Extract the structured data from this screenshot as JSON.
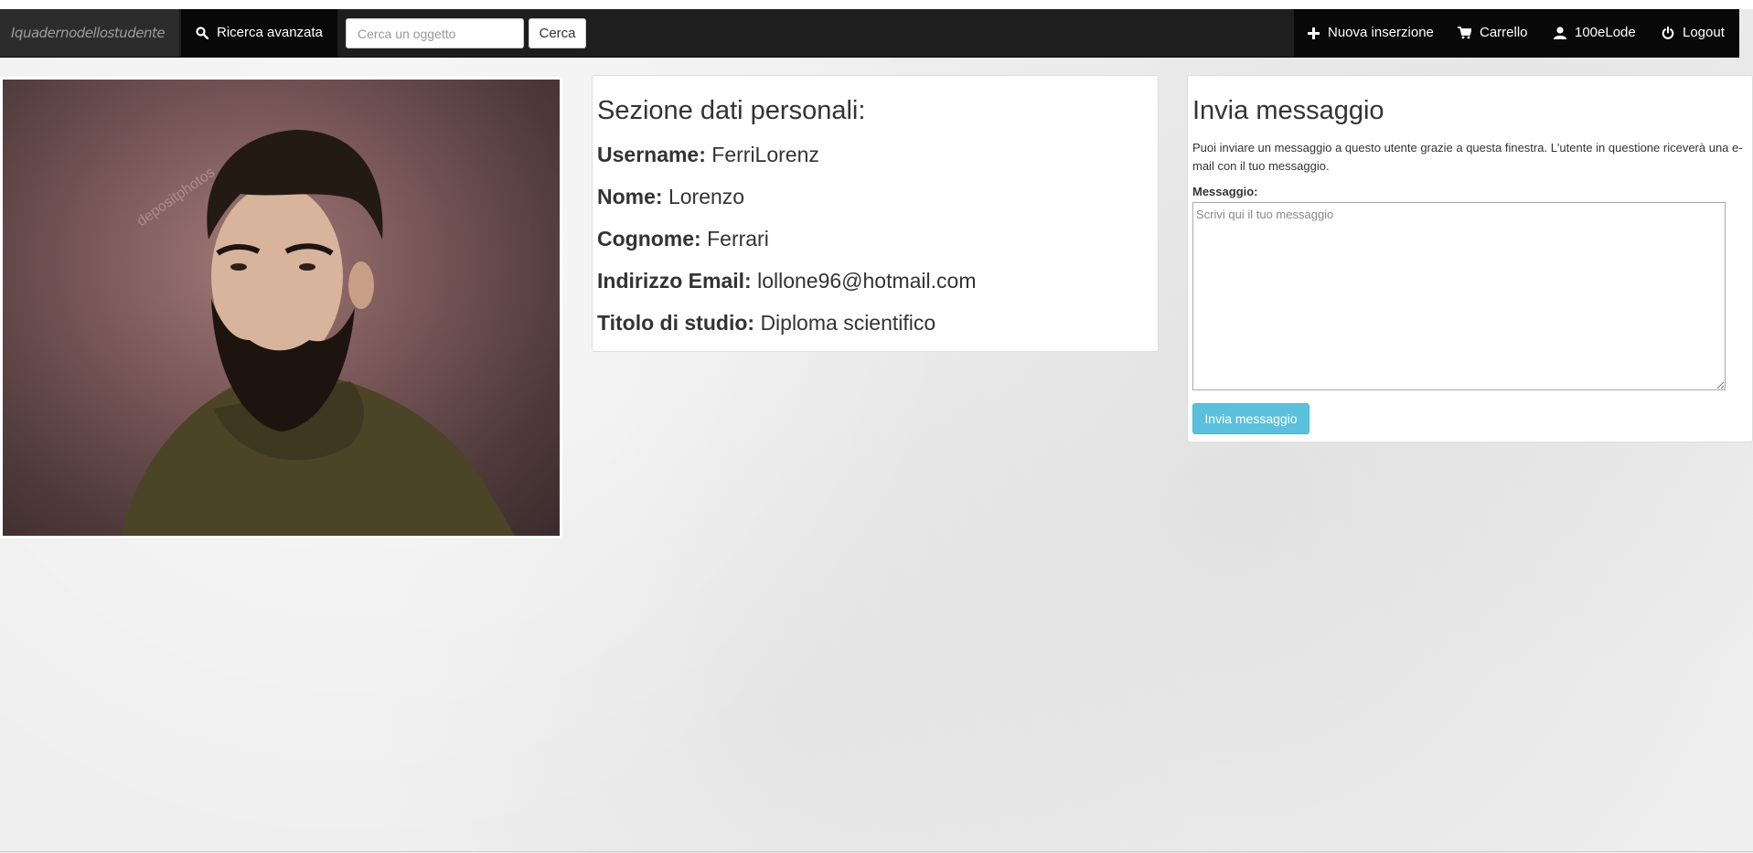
{
  "navbar": {
    "brand": "Iquadernodellostudente",
    "advanced_search": "Ricerca avanzata",
    "search_placeholder": "Cerca un oggetto",
    "search_button": "Cerca",
    "new_listing": "Nuova inserzione",
    "cart": "Carrello",
    "user": "100eLode",
    "logout": "Logout"
  },
  "profile": {
    "photo_watermark": "depositphotos",
    "section_title": "Sezione dati personali:",
    "fields": [
      {
        "label": "Username:",
        "value": "FerriLorenz"
      },
      {
        "label": "Nome:",
        "value": "Lorenzo"
      },
      {
        "label": "Cognome:",
        "value": "Ferrari"
      },
      {
        "label": "Indirizzo Email:",
        "value": "lollone96@hotmail.com"
      },
      {
        "label": "Titolo di studio:",
        "value": "Diploma scientifico"
      }
    ]
  },
  "message": {
    "title": "Invia messaggio",
    "description": "Puoi inviare un messaggio a questo utente grazie a questa finestra. L'utente in questione riceverà una e-mail con il tuo messaggio.",
    "field_label": "Messaggio:",
    "placeholder": "Scrivi qui il tuo messaggio",
    "send_button": "Invia messaggio",
    "button_color": "#5bc0de"
  }
}
